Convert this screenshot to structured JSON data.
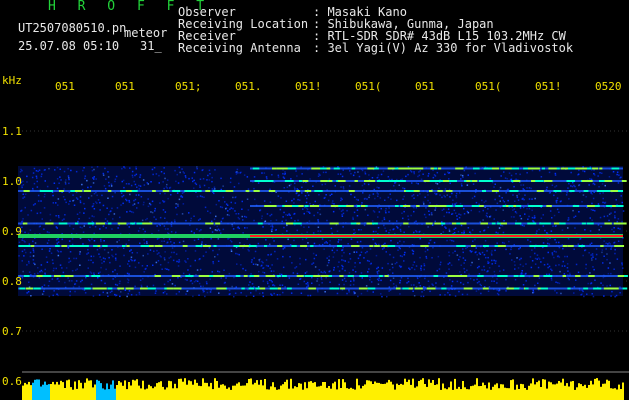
{
  "header": {
    "station": "H R O F F T",
    "file": "UT2507080510.pn",
    "meteor_label": "meteor",
    "datetime": "25.07.08 05:10",
    "count": "31_",
    "fields": [
      {
        "label": "Observer",
        "value": ": Masaki Kano"
      },
      {
        "label": "Receiving Location",
        "value": ": Shibukawa, Gunma, Japan"
      },
      {
        "label": "Receiver",
        "value": ": RTL-SDR SDR# 43dB L15 103.2MHz CW"
      },
      {
        "label": "Receiving Antenna",
        "value": ": 3el Yagi(V) Az 330 for Vladivostok"
      }
    ]
  },
  "spectrogram": {
    "y_unit": "kHz",
    "y_ticks": [
      "1.1",
      "1.0",
      "0.9",
      "0.8",
      "0.7",
      "0.6"
    ],
    "x_ticks": [
      "051",
      "051",
      "051;",
      "051.",
      "051!",
      "051(",
      "051",
      "051(",
      "051!",
      "0520"
    ],
    "carrier_khz": 0.89,
    "bands_khz": [
      0.785,
      0.81,
      0.87,
      0.89,
      0.915,
      0.95,
      0.98,
      1.0,
      1.025
    ],
    "colors": {
      "text": "#f0e000",
      "noise": "#0030ff",
      "strong": "#ff2020",
      "bar": "#fff000",
      "meter": "#00bfff"
    }
  }
}
